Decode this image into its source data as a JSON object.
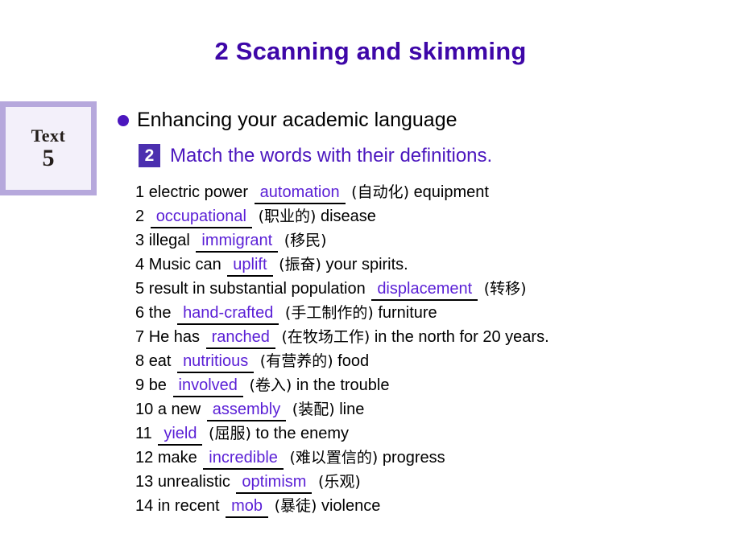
{
  "slide": {
    "title": "2 Scanning and skimming",
    "title_color": "#3E07A8",
    "background_color": "#ffffff"
  },
  "text_box": {
    "label": "Text",
    "number": "5",
    "border_color": "#B6A8DC",
    "fill_color": "#F3F0FA"
  },
  "bullet": {
    "icon": "filled-circle-bullet",
    "text": "Enhancing your academic language",
    "color": "#4B16BE"
  },
  "task": {
    "badge_number": "2",
    "badge_color": "#4B2FAF",
    "heading": "Match the words with their definitions.",
    "heading_color": "#4B16BE"
  },
  "answer_color": "#5A1FD6",
  "exercises": [
    {
      "num": "1",
      "before": "electric power",
      "answer": "automation",
      "gloss": "(自动化)",
      "after": "equipment"
    },
    {
      "num": "2",
      "before": "",
      "answer": "occupational",
      "gloss": "(职业的)",
      "after": "disease"
    },
    {
      "num": "3",
      "before": "illegal",
      "answer": "immigrant",
      "gloss": "(移民)",
      "after": ""
    },
    {
      "num": "4",
      "before": "Music can",
      "answer": "uplift",
      "gloss": "(振奋)",
      "after": "your spirits."
    },
    {
      "num": "5",
      "before": "result in substantial population",
      "answer": "displacement",
      "gloss": "(转移)",
      "after": ""
    },
    {
      "num": "6",
      "before": "the",
      "answer": "hand-crafted",
      "gloss": "(手工制作的)",
      "after": "furniture"
    },
    {
      "num": "7",
      "before": "He has",
      "answer": "ranched",
      "gloss": "(在牧场工作)",
      "after": "in the north for 20 years."
    },
    {
      "num": "8",
      "before": "eat",
      "answer": "nutritious",
      "gloss": "(有营养的)",
      "after": "food"
    },
    {
      "num": "9",
      "before": "be",
      "answer": "involved",
      "gloss": "(卷入)",
      "after": "in the trouble"
    },
    {
      "num": "10",
      "before": "a new",
      "answer": "assembly",
      "gloss": "(装配)",
      "after": "line"
    },
    {
      "num": "11",
      "before": "",
      "answer": "yield",
      "gloss": "(屈服)",
      "after": "to the enemy"
    },
    {
      "num": "12",
      "before": "make",
      "answer": "incredible",
      "gloss": "(难以置信的)",
      "after": "progress"
    },
    {
      "num": "13",
      "before": "unrealistic",
      "answer": "optimism",
      "gloss": "(乐观)",
      "after": ""
    },
    {
      "num": "14",
      "before": "in recent",
      "answer": "mob",
      "gloss": "(暴徒)",
      "after": "violence"
    }
  ]
}
